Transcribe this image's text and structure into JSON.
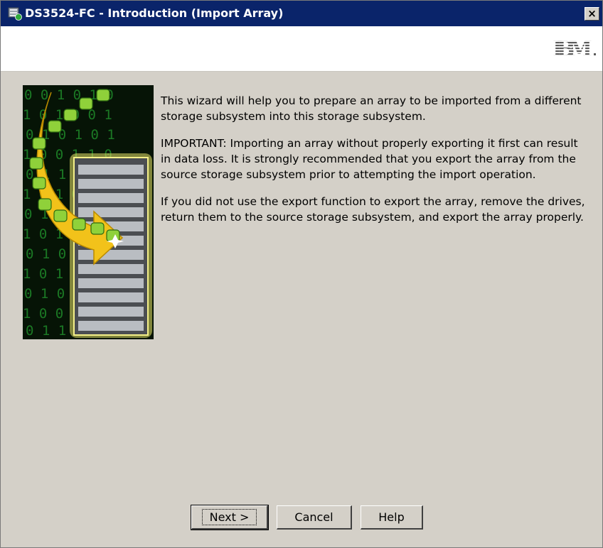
{
  "window": {
    "title": "DS3524-FC - Introduction (Import Array)",
    "close_label": "×"
  },
  "header": {
    "logo": "IBM."
  },
  "content": {
    "paragraph1": "This wizard will help you to prepare an array to be imported from a different storage subsystem into this storage subsystem.",
    "paragraph2": "IMPORTANT: Importing an array without properly exporting it first can result in data loss. It is strongly recommended that you export the array from the source storage subsystem prior to attempting the import operation.",
    "paragraph3": "If you did not use the export function to export the array, remove the drives, return them to the source storage subsystem, and export the array properly."
  },
  "buttons": {
    "next": "Next >",
    "cancel": "Cancel",
    "help": "Help"
  },
  "colors": {
    "titlebar": "#0a246a",
    "dialog_bg": "#d4d0c8",
    "arrow": "#f2c21a",
    "drive": "#8fd13a",
    "digits": "#2ea82e"
  }
}
